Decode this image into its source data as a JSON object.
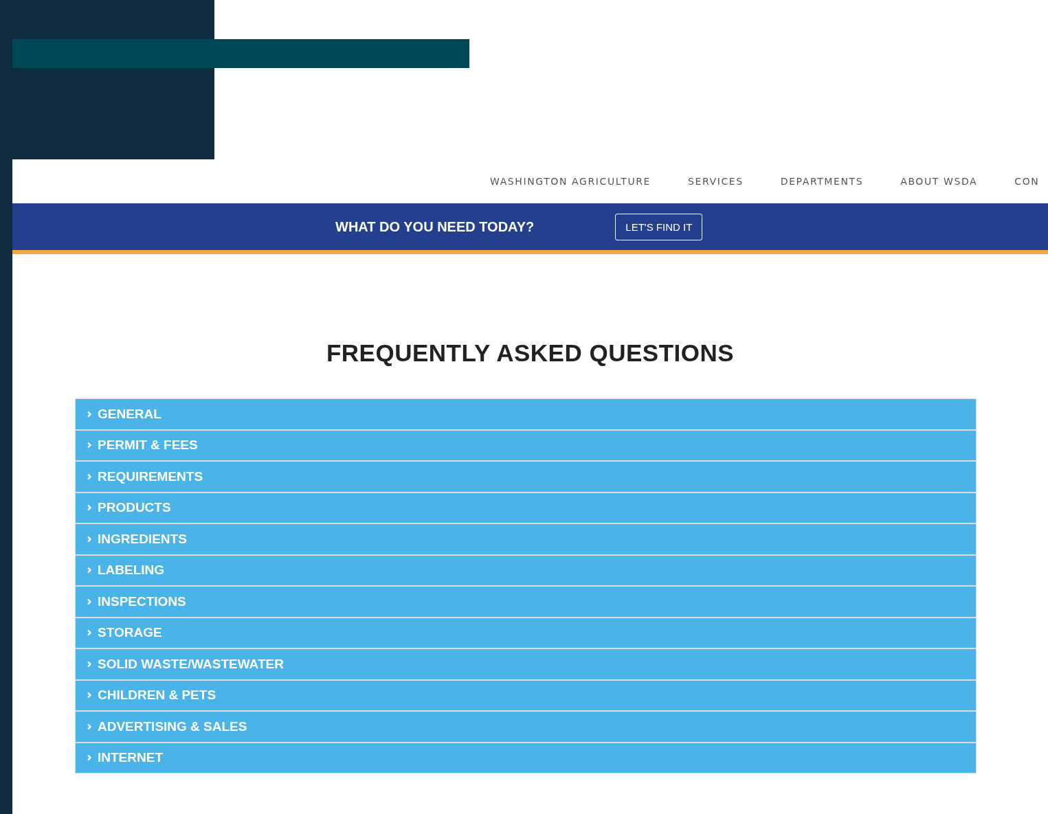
{
  "nav": {
    "items": [
      {
        "label": "WASHINGTON AGRICULTURE"
      },
      {
        "label": "SERVICES"
      },
      {
        "label": "DEPARTMENTS"
      },
      {
        "label": "ABOUT WSDA"
      },
      {
        "label": "CON"
      }
    ]
  },
  "banner": {
    "question": "WHAT DO YOU NEED TODAY?",
    "button": "LET'S FIND IT"
  },
  "faq": {
    "title": "FREQUENTLY ASKED QUESTIONS",
    "items": [
      {
        "label": "GENERAL",
        "expanded": false
      },
      {
        "label": "PERMIT & FEES",
        "expanded": false
      },
      {
        "label": "REQUIREMENTS",
        "expanded": false
      },
      {
        "label": "PRODUCTS",
        "expanded": false
      },
      {
        "label": "INGREDIENTS",
        "expanded": false
      },
      {
        "label": "LABELING",
        "expanded": false
      },
      {
        "label": "INSPECTIONS",
        "expanded": false
      },
      {
        "label": "STORAGE",
        "expanded": false
      },
      {
        "label": "SOLID WASTE/WASTEWATER",
        "expanded": false
      },
      {
        "label": "CHILDREN & PETS",
        "expanded": false
      },
      {
        "label": "ADVERTISING & SALES",
        "expanded": false
      },
      {
        "label": "INTERNET",
        "expanded": false
      }
    ]
  }
}
